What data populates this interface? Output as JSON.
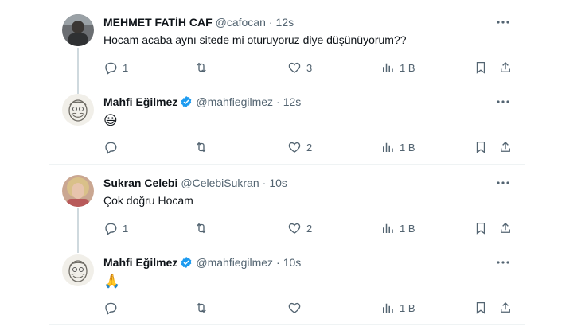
{
  "colors": {
    "accent": "#1d9bf0",
    "secondary_text": "#536471",
    "thread_line": "#cfd9de",
    "divider": "#eff3f4"
  },
  "tweets": [
    {
      "name": "MEHMET FATİH CAF",
      "handle": "@cafocan",
      "dot": "·",
      "time": "12s",
      "text": "Hocam acaba aynı sitede mi oturuyoruz  diye düşünüyorum??",
      "verified": false,
      "replies": "1",
      "retweets": "",
      "likes": "3",
      "views": "1 B"
    },
    {
      "name": "Mahfi Eğilmez",
      "handle": "@mahfiegilmez",
      "dot": "·",
      "time": "12s",
      "text": "😃",
      "verified": true,
      "replies": "",
      "retweets": "",
      "likes": "2",
      "views": "1 B"
    },
    {
      "name": "Sukran Celebi",
      "handle": "@CelebiSukran",
      "dot": "·",
      "time": "10s",
      "text": "Çok doğru Hocam",
      "verified": false,
      "replies": "1",
      "retweets": "",
      "likes": "2",
      "views": "1 B"
    },
    {
      "name": "Mahfi Eğilmez",
      "handle": "@mahfiegilmez",
      "dot": "·",
      "time": "10s",
      "text": "🙏",
      "verified": true,
      "replies": "",
      "retweets": "",
      "likes": "",
      "views": "1 B"
    }
  ]
}
